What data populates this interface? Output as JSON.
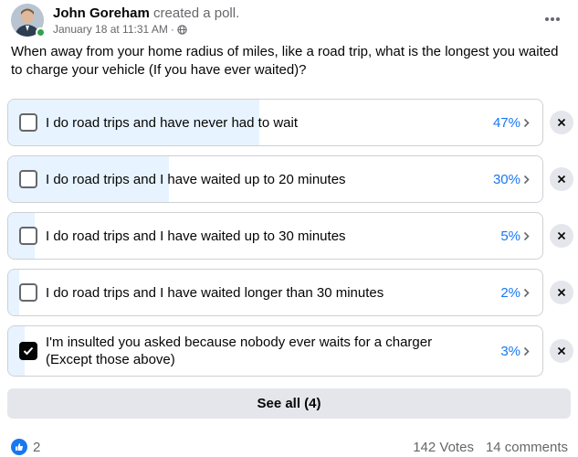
{
  "post": {
    "author": "John Goreham",
    "action": "created a poll.",
    "date": "January 18 at 11:31 AM",
    "separator": "·",
    "privacy_icon": "globe-icon",
    "more_icon": "more-horizontal-icon",
    "question": "When away from your home radius of miles, like a road trip, what is the longest you waited to charge your vehicle (If you have ever waited)?"
  },
  "poll": {
    "options": [
      {
        "label": "I do road trips and have never had to wait",
        "percent": "47%",
        "fraction": 0.47,
        "checked": false
      },
      {
        "label": "I do road trips and I have waited up to 20 minutes",
        "percent": "30%",
        "fraction": 0.3,
        "checked": false
      },
      {
        "label": "I do road trips and I have waited up to 30 minutes",
        "percent": "5%",
        "fraction": 0.05,
        "checked": false
      },
      {
        "label": "I do road trips and I have waited longer than 30 minutes",
        "percent": "2%",
        "fraction": 0.02,
        "checked": false
      },
      {
        "label": "I'm insulted you asked because nobody ever waits for a charger (Except those above)",
        "percent": "3%",
        "fraction": 0.03,
        "checked": true
      }
    ],
    "see_all_label": "See all (4)"
  },
  "footer": {
    "reaction_icon": "like-icon",
    "reaction_count": "2",
    "votes": "142 Votes",
    "comments": "14 comments"
  },
  "colors": {
    "accent": "#1877f2",
    "fill": "#e7f3ff",
    "secondary_text": "#65676b",
    "button_bg": "#e4e6eb",
    "online": "#31a24c"
  }
}
